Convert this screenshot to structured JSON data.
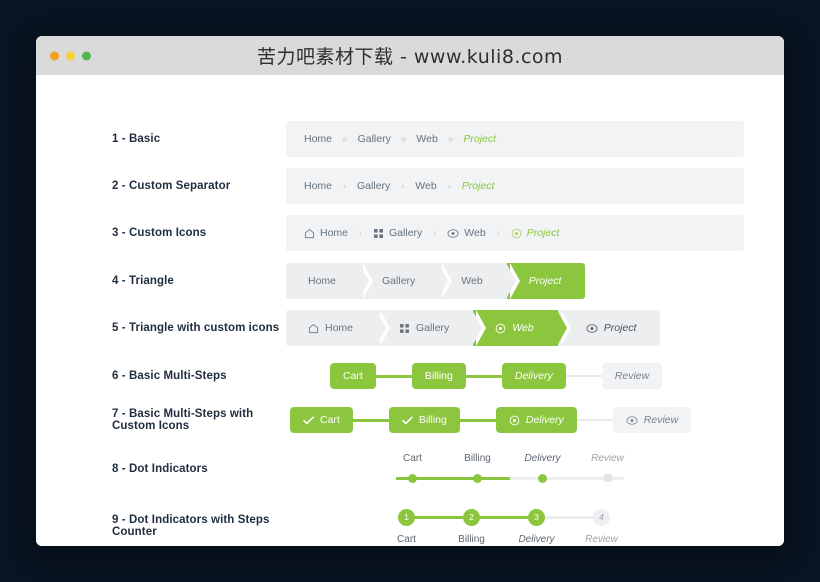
{
  "window": {
    "title": "苦力吧素材下载 - www.kuli8.com",
    "lights": [
      "close-light",
      "minimize-light",
      "maximize-light"
    ]
  },
  "rows": [
    {
      "label": "1 - Basic",
      "sep": "»",
      "items": [
        {
          "text": "Home"
        },
        {
          "text": "Gallery"
        },
        {
          "text": "Web"
        },
        {
          "text": "Project",
          "state": "active"
        }
      ]
    },
    {
      "label": "2 - Custom Separator",
      "sep": "›",
      "items": [
        {
          "text": "Home"
        },
        {
          "text": "Gallery"
        },
        {
          "text": "Web"
        },
        {
          "text": "Project",
          "state": "active"
        }
      ]
    },
    {
      "label": "3 - Custom Icons",
      "sep": "›",
      "items": [
        {
          "text": "Home",
          "icon": "home-icon"
        },
        {
          "text": "Gallery",
          "icon": "grid-icon"
        },
        {
          "text": "Web",
          "icon": "eye-icon"
        },
        {
          "text": "Project",
          "icon": "target-icon",
          "state": "active"
        }
      ]
    },
    {
      "label": "4 - Triangle",
      "items": [
        {
          "text": "Home"
        },
        {
          "text": "Gallery"
        },
        {
          "text": "Web"
        },
        {
          "text": "Project",
          "state": "active"
        }
      ]
    },
    {
      "label": "5 - Triangle with custom icons",
      "items": [
        {
          "text": "Home",
          "icon": "home-icon"
        },
        {
          "text": "Gallery",
          "icon": "grid-icon"
        },
        {
          "text": "Web",
          "icon": "target-icon",
          "state": "active"
        },
        {
          "text": "Project",
          "icon": "eye-icon",
          "state": "pending"
        }
      ]
    },
    {
      "label": "6 - Basic Multi-Steps",
      "items": [
        {
          "text": "Cart",
          "state": "done"
        },
        {
          "text": "Billing",
          "state": "done"
        },
        {
          "text": "Delivery",
          "state": "current"
        },
        {
          "text": "Review",
          "state": "off"
        }
      ]
    },
    {
      "label": "7 - Basic Multi-Steps with Custom Icons",
      "items": [
        {
          "text": "Cart",
          "icon": "check-icon",
          "state": "done"
        },
        {
          "text": "Billing",
          "icon": "check-icon",
          "state": "done"
        },
        {
          "text": "Delivery",
          "icon": "target-icon",
          "state": "current"
        },
        {
          "text": "Review",
          "icon": "eye-icon",
          "state": "off"
        }
      ]
    },
    {
      "label": "8 - Dot Indicators",
      "items": [
        {
          "text": "Cart",
          "state": "done"
        },
        {
          "text": "Billing",
          "state": "done"
        },
        {
          "text": "Delivery",
          "state": "current"
        },
        {
          "text": "Review",
          "state": "off"
        }
      ]
    },
    {
      "label": "9 - Dot Indicators with Steps Counter",
      "items": [
        {
          "text": "Cart",
          "num": "1",
          "state": "done"
        },
        {
          "text": "Billing",
          "num": "2",
          "state": "done"
        },
        {
          "text": "Delivery",
          "num": "3",
          "state": "current"
        },
        {
          "text": "Review",
          "num": "4",
          "state": "off"
        }
      ]
    }
  ],
  "colors": {
    "accent": "#8cc63e",
    "page_bg": "#091422",
    "titlebar": "#dadada",
    "bar_bg": "#f1f3f4",
    "muted_text": "#66737f",
    "label_text": "#1f2d3d"
  }
}
